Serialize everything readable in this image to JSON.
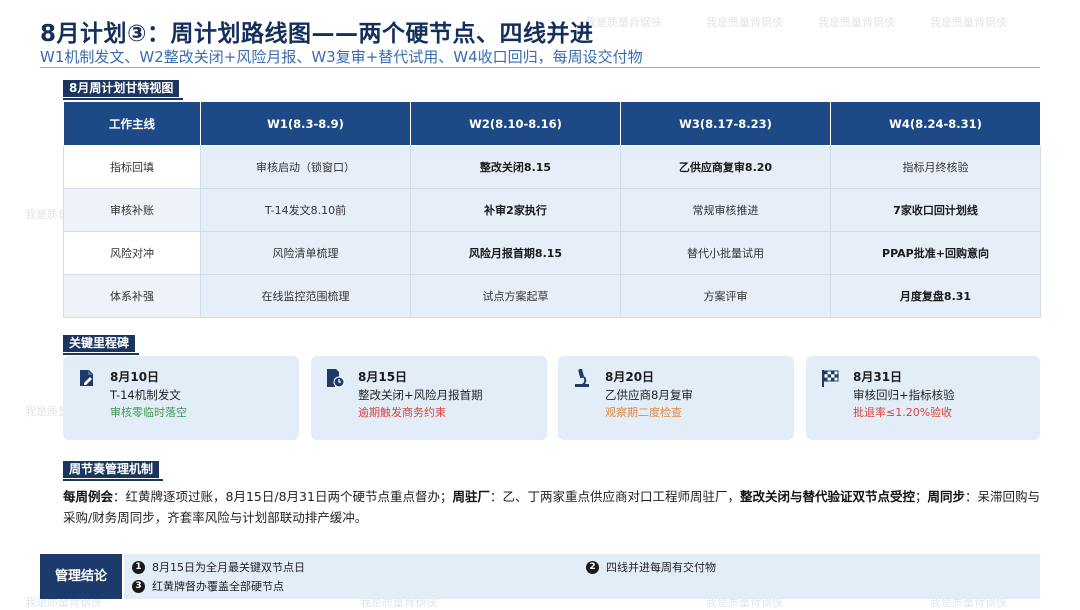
{
  "header": {
    "title": "8月计划③：周计划路线图——两个硬节点、四线并进",
    "subtitle": "W1机制发文、W2整改关闭+风险月报、W3复审+替代试用、W4收口回归，每周设交付物"
  },
  "gantt": {
    "section_label": "8月周计划甘特视图",
    "headers": [
      "工作主线",
      "W1(8.3-8.9)",
      "W2(8.10-8.16)",
      "W3(8.17-8.23)",
      "W4(8.24-8.31)"
    ],
    "rows": [
      {
        "line": "指标回填",
        "cells": [
          "审核启动（锁窗口）",
          "整改关闭8.15",
          "乙供应商复审8.20",
          "指标月终核验"
        ]
      },
      {
        "line": "审核补账",
        "cells": [
          "T-14发文8.10前",
          "补审2家执行",
          "常规审核推进",
          "7家收口回计划线"
        ]
      },
      {
        "line": "风险对冲",
        "cells": [
          "风险清单梳理",
          "风险月报首期8.15",
          "替代小批量试用",
          "PPAP批准+回购意向"
        ]
      },
      {
        "line": "体系补强",
        "cells": [
          "在线监控范围梳理",
          "试点方案起草",
          "方案评审",
          "月度复盘8.31"
        ]
      }
    ]
  },
  "milestones": {
    "section_label": "关键里程碑",
    "items": [
      {
        "date": "8月10日",
        "desc": "T-14机制发文",
        "note": "审核零临时落空",
        "note_color": "#3c9a55",
        "icon": "document-edit-icon"
      },
      {
        "date": "8月15日",
        "desc": "整改关闭+风险月报首期",
        "note": "逾期触发商务约束",
        "note_color": "#d4453f",
        "icon": "document-clock-icon"
      },
      {
        "date": "8月20日",
        "desc": "乙供应商8月复审",
        "note": "观察期二度检查",
        "note_color": "#e0893a",
        "icon": "microscope-icon"
      },
      {
        "date": "8月31日",
        "desc": "审核回归+指标核验",
        "note": "批退率≤1.20%验收",
        "note_color": "#d4453f",
        "icon": "checkered-flag-icon"
      }
    ]
  },
  "rhythm": {
    "section_label": "周节奏管理机制",
    "k1": "每周例会",
    "t1": "：红黄牌逐项过账，8月15日/8月31日两个硬节点重点督办；",
    "k2": "周驻厂",
    "t2": "：乙、丁两家重点供应商对口工程师周驻厂，",
    "k3": "整改关闭与替代验证双节点受控",
    "t3": "；",
    "k4": "周同步",
    "t4": "：呆滞回购与采购/财务周同步，齐套率风险与计划部联动排产缓冲。"
  },
  "conclusion": {
    "label": "管理结论",
    "items": [
      {
        "num": "1",
        "text": "8月15日为全月最关键双节点日"
      },
      {
        "num": "2",
        "text": "四线并进每周有交付物"
      },
      {
        "num": "3",
        "text": "红黄牌督办覆盖全部硬节点"
      }
    ]
  },
  "watermark": "我是质量背钢侠",
  "colors": {
    "navy": "#1d4a87",
    "cell_bg": "#e6eef8",
    "card_bg": "#e3edf8"
  }
}
